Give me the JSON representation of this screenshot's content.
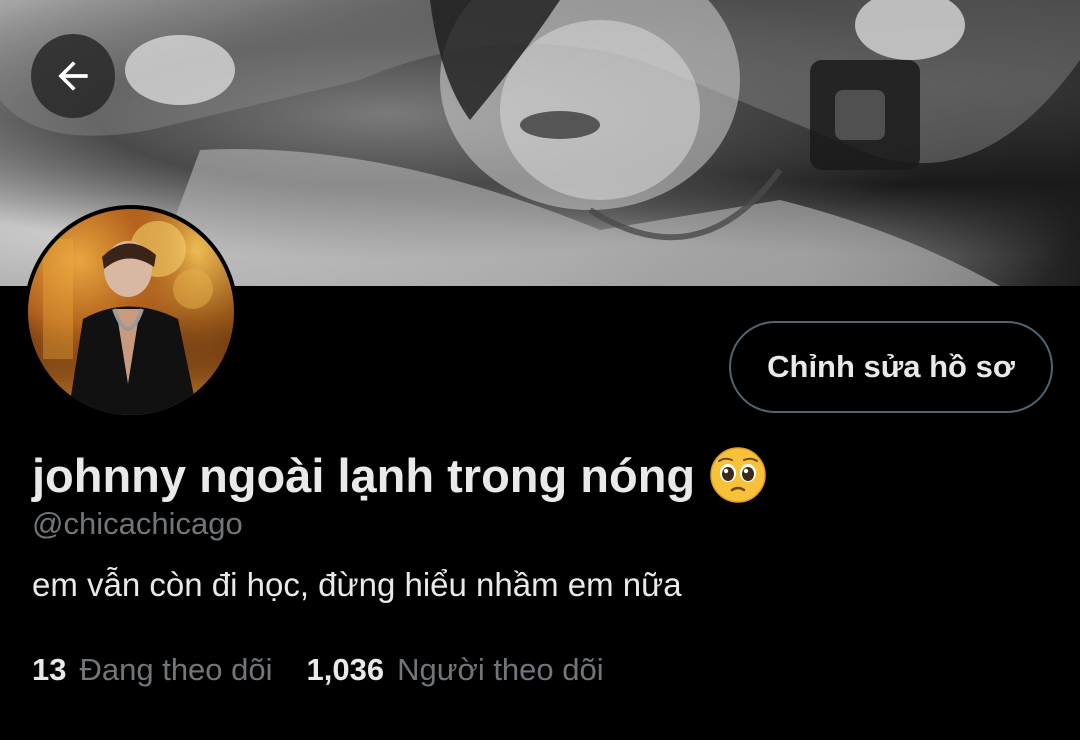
{
  "header": {
    "back_icon": "arrow-left-icon"
  },
  "profile": {
    "edit_button_label": "Chỉnh sửa hồ sơ",
    "display_name": "johnny ngoài lạnh trong nóng",
    "name_emoji": "pleading-face-emoji",
    "handle": "@chicachicago",
    "bio": "em vẫn còn đi học, đừng hiểu nhầm em nữa"
  },
  "stats": {
    "following_count": "13",
    "following_label": "Đang theo dõi",
    "followers_count": "1,036",
    "followers_label": "Người theo dõi"
  },
  "colors": {
    "background": "#000000",
    "primary_text": "#e7e9ea",
    "secondary_text": "#71767b",
    "button_border": "#536471"
  }
}
